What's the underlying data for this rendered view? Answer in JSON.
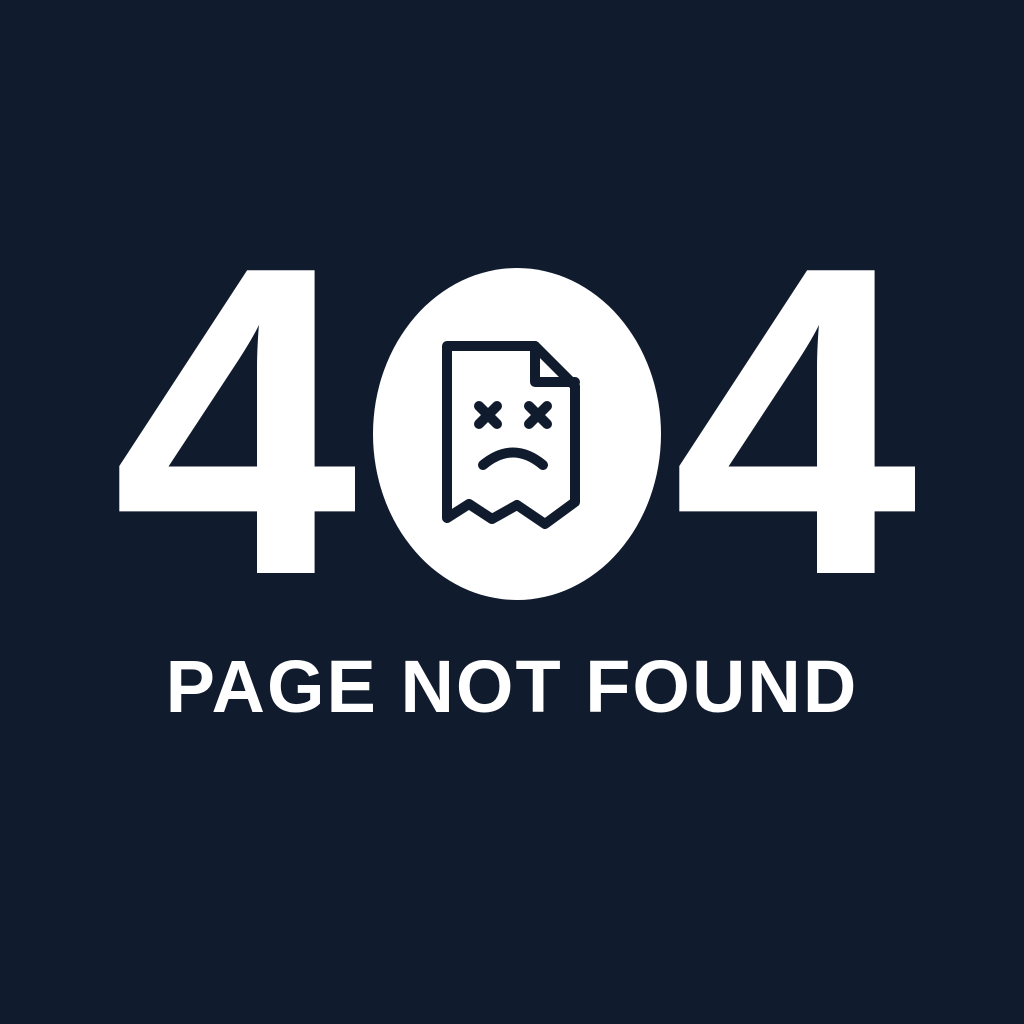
{
  "error": {
    "digit_left": "4",
    "digit_right": "4",
    "middle_icon": "broken-file-sad-face-icon",
    "title": "PAGE NOT FOUND"
  },
  "colors": {
    "background": "#101b2d",
    "foreground": "#ffffff"
  }
}
